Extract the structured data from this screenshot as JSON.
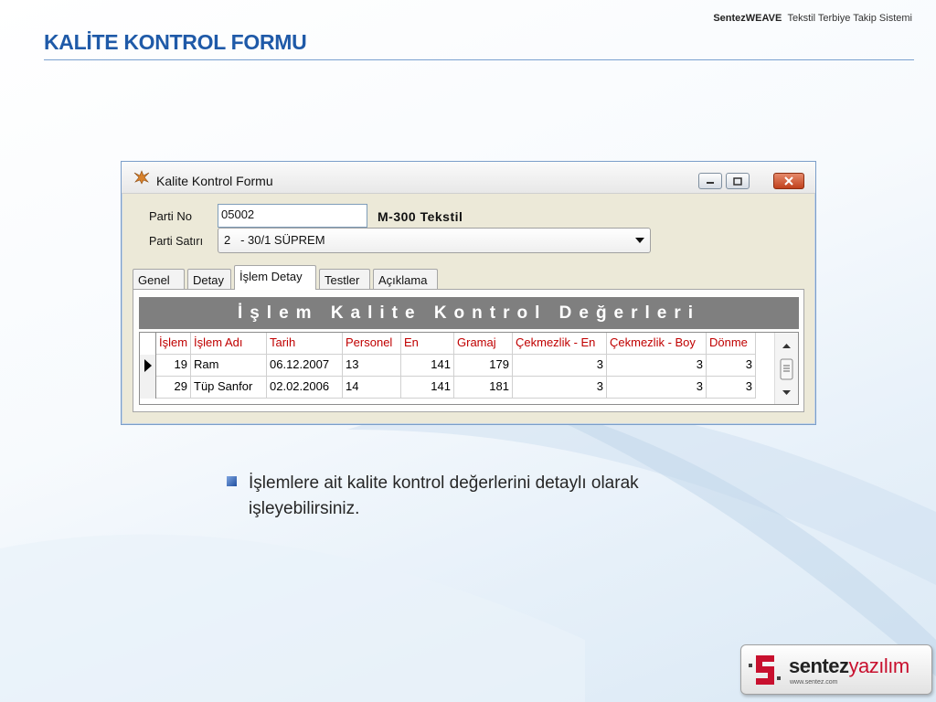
{
  "header": {
    "brand": "SentezWEAVE",
    "tagline": "Tekstil Terbiye Takip Sistemi",
    "slide_title": "KALİTE KONTROL FORMU"
  },
  "window": {
    "title": "Kalite Kontrol Formu",
    "parti_no_label": "Parti No",
    "parti_no_value": "05002",
    "company": "M-300 Tekstil",
    "parti_satiri_label": "Parti Satırı",
    "parti_satiri_value": "2   - 30/1 SÜPREM",
    "tabs": [
      "Genel",
      "Detay",
      "İşlem Detay",
      "Testler",
      "Açıklama"
    ],
    "active_tab": "İşlem Detay",
    "banner": "İşlem Kalite Kontrol Değerleri",
    "table": {
      "columns": [
        "İşlem",
        "İşlem Adı",
        "Tarih",
        "Personel",
        "En",
        "Gramaj",
        "Çekmezlik - En",
        "Çekmezlik - Boy",
        "Dönme"
      ],
      "rows": [
        [
          "19",
          "Ram",
          "06.12.2007",
          "13",
          "141",
          "179",
          "3",
          "3",
          "3"
        ],
        [
          "29",
          "Tüp Sanfor",
          "02.02.2006",
          "14",
          "141",
          "181",
          "3",
          "3",
          "3"
        ]
      ]
    }
  },
  "bullet": "İşlemlere ait kalite kontrol değerlerini detaylı olarak işleyebilirsiniz.",
  "logo": {
    "part1": "sentez",
    "part2": "yazılım",
    "url": "www.sentez.com"
  },
  "colors": {
    "title": "#1f5aa8",
    "grid_header": "#c00000",
    "banner_bg": "#7f7f7f"
  },
  "icons": [
    "app-icon",
    "minimize-icon",
    "maximize-icon",
    "close-icon",
    "dropdown-arrow-icon",
    "row-pointer-icon",
    "scroll-up-icon",
    "scroll-thumb-icon",
    "scroll-down-icon",
    "bullet-icon",
    "logo-mark-icon"
  ]
}
